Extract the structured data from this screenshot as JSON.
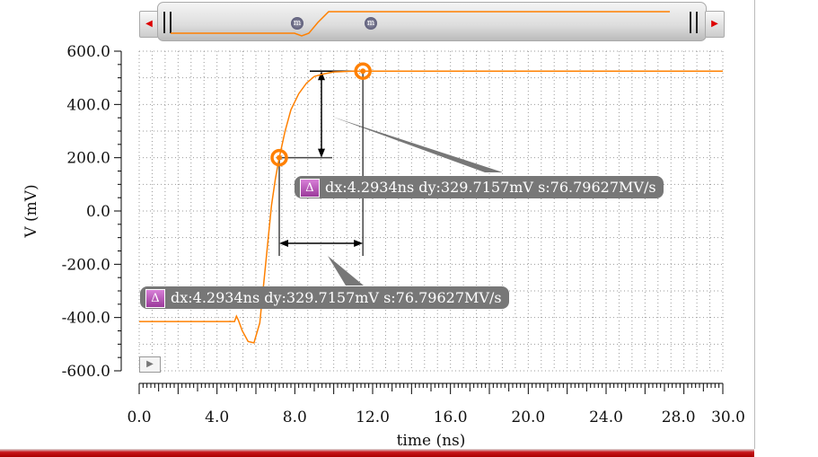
{
  "chart_data": {
    "type": "line",
    "xlabel": "time (ns)",
    "ylabel": "V (mV)",
    "xlim": [
      0,
      30
    ],
    "ylim": [
      -600,
      600
    ],
    "x_ticks": [
      "0.0",
      "4.0",
      "8.0",
      "12.0",
      "16.0",
      "20.0",
      "24.0",
      "28.0",
      "30.0"
    ],
    "x_tick_values": [
      0,
      4,
      8,
      12,
      16,
      20,
      24,
      28,
      30
    ],
    "y_ticks": [
      "600.0",
      "400.0",
      "200.0",
      "0.0",
      "-200.0",
      "-400.0",
      "-600.0"
    ],
    "y_tick_values": [
      600,
      400,
      200,
      0,
      -200,
      -400,
      -600
    ],
    "grid": true,
    "series": [
      {
        "name": "V",
        "color": "#ff8000",
        "x": [
          0,
          4.9,
          5.0,
          5.1,
          5.3,
          5.6,
          5.9,
          6.2,
          6.5,
          6.8,
          7.0,
          7.2,
          7.5,
          7.8,
          8.2,
          8.6,
          9.0,
          9.5,
          10.0,
          11.0,
          12.0,
          30.0
        ],
        "y": [
          -415,
          -415,
          -395,
          -410,
          -450,
          -490,
          -495,
          -420,
          -200,
          20,
          120,
          200,
          300,
          380,
          440,
          480,
          505,
          515,
          522,
          525,
          525,
          525
        ]
      }
    ],
    "markers": [
      {
        "x": 7.2,
        "y": 200
      },
      {
        "x": 11.5,
        "y": 525
      }
    ],
    "annotations": [
      {
        "delta_icon": "Δ",
        "text": "dx:4.2934ns dy:329.7157mV s:76.79627MV/s"
      },
      {
        "delta_icon": "Δ",
        "text": "dx:4.2934ns dy:329.7157mV s:76.79627MV/s"
      }
    ]
  },
  "scroller": {
    "marker_label": "m",
    "left_arrow": "◀",
    "right_arrow": "▶"
  },
  "play_icon": "▶"
}
